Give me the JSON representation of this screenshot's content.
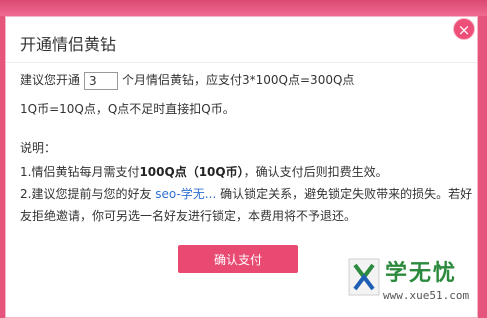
{
  "dialog": {
    "title": "开通情侣黄钻",
    "close_symbol": "×",
    "purchase": {
      "prefix": "建议您开通",
      "months_value": "3",
      "suffix": "个月情侣黄钻，应支付3*100Q点=300Q点"
    },
    "exchange_note": "1Q币=10Q点，Q点不足时直接扣Q币。",
    "notes_heading": "说明：",
    "note1": {
      "prefix": "1.情侣黄钻每月需支付",
      "bold": "100Q点（10Q币）",
      "suffix": "，确认支付后则扣费生效。"
    },
    "note2": {
      "prefix": "2.建议您提前与您的好友",
      "friend": "seo-学无...",
      "suffix": "确认锁定关系，避免锁定失败带来的损失。若好",
      "line2": "友拒绝邀请，你可另选一名好友进行锁定，本费用将不予退还。"
    },
    "confirm_label": "确认支付"
  },
  "watermark": {
    "name": "学无忧",
    "url": "www.xue51.com"
  }
}
